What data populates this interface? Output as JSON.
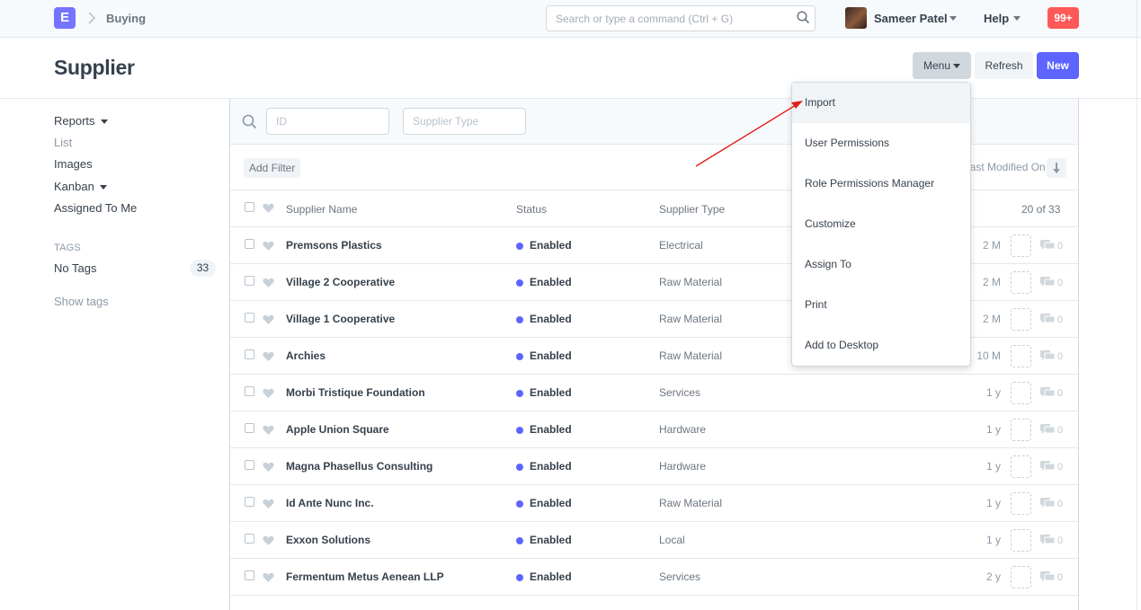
{
  "navbar": {
    "logo_letter": "E",
    "breadcrumb": "Buying",
    "search_placeholder": "Search or type a command (Ctrl + G)",
    "user_name": "Sameer Patel",
    "help_label": "Help",
    "notification_count": "99+"
  },
  "page": {
    "title": "Supplier",
    "menu_button": "Menu",
    "refresh_button": "Refresh",
    "new_button": "New"
  },
  "sidebar": {
    "reports": "Reports",
    "list": "List",
    "images": "Images",
    "kanban": "Kanban",
    "assigned_to_me": "Assigned To Me",
    "tags_label": "TAGS",
    "no_tags": "No Tags",
    "no_tags_count": "33",
    "show_tags": "Show tags"
  },
  "filters": {
    "id_placeholder": "ID",
    "supplier_type_placeholder": "Supplier Type",
    "add_filter": "Add Filter",
    "sort_label": "Last Modified On"
  },
  "list": {
    "columns": {
      "name": "Supplier Name",
      "status": "Status",
      "type": "Supplier Type"
    },
    "paging": "20 of 33",
    "rows": [
      {
        "name": "Premsons Plastics",
        "status": "Enabled",
        "type": "Electrical",
        "modified": "2 M",
        "comments": "0"
      },
      {
        "name": "Village 2 Cooperative",
        "status": "Enabled",
        "type": "Raw Material",
        "modified": "2 M",
        "comments": "0"
      },
      {
        "name": "Village 1 Cooperative",
        "status": "Enabled",
        "type": "Raw Material",
        "modified": "2 M",
        "comments": "0"
      },
      {
        "name": "Archies",
        "status": "Enabled",
        "type": "Raw Material",
        "modified": "10 M",
        "comments": "0"
      },
      {
        "name": "Morbi Tristique Foundation",
        "status": "Enabled",
        "type": "Services",
        "modified": "1 y",
        "comments": "0"
      },
      {
        "name": "Apple Union Square",
        "status": "Enabled",
        "type": "Hardware",
        "modified": "1 y",
        "comments": "0"
      },
      {
        "name": "Magna Phasellus Consulting",
        "status": "Enabled",
        "type": "Hardware",
        "modified": "1 y",
        "comments": "0"
      },
      {
        "name": "Id Ante Nunc Inc.",
        "status": "Enabled",
        "type": "Raw Material",
        "modified": "1 y",
        "comments": "0"
      },
      {
        "name": "Exxon Solutions",
        "status": "Enabled",
        "type": "Local",
        "modified": "1 y",
        "comments": "0"
      },
      {
        "name": "Fermentum Metus Aenean LLP",
        "status": "Enabled",
        "type": "Services",
        "modified": "2 y",
        "comments": "0"
      }
    ]
  },
  "menu_dropdown": {
    "items": [
      "Import",
      "User Permissions",
      "Role Permissions Manager",
      "Customize",
      "Assign To",
      "Print",
      "Add to Desktop"
    ]
  },
  "colors": {
    "brand": "#7574ff",
    "primary_button": "#5e64ff",
    "status_dot": "#5e64ff",
    "notification": "#ff5858",
    "annotation_arrow": "#e0201c"
  }
}
